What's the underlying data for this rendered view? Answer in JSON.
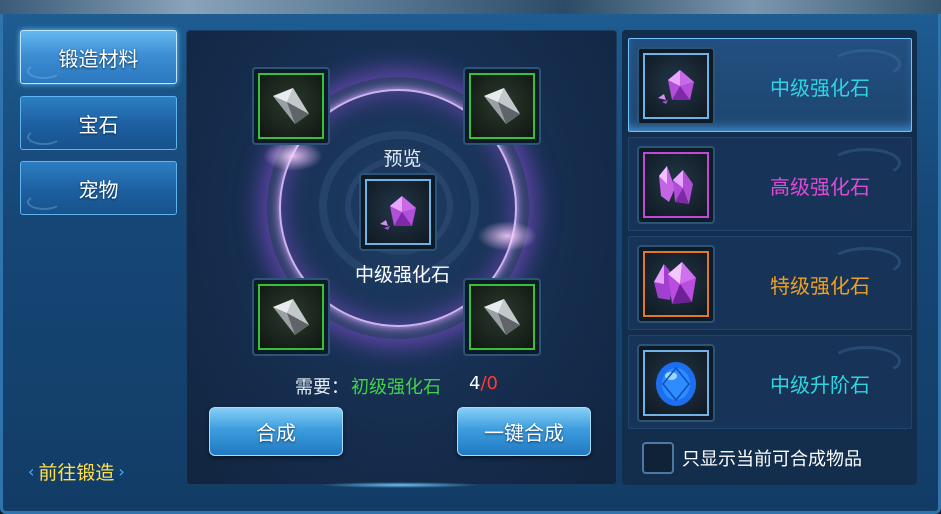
{
  "categories": [
    {
      "label": "锻造材料",
      "active": true
    },
    {
      "label": "宝石",
      "active": false
    },
    {
      "label": "宠物",
      "active": false
    }
  ],
  "goto_forge": "前往锻造",
  "center": {
    "preview_label": "预览",
    "preview_item_name": "中级强化石",
    "requirement_label": "需要：",
    "requirement_material": "初级强化石",
    "requirement_have": "4",
    "requirement_separator": "/",
    "requirement_need": "0",
    "synthesize_button": "合成",
    "synthesize_all_button": "一键合成"
  },
  "items": [
    {
      "name": "中级强化石",
      "color": "#2fd6e0",
      "icon": "purple-crystal-small-icon",
      "active": true
    },
    {
      "name": "高级强化石",
      "color": "#e04ad8",
      "icon": "purple-crystal-cluster-icon",
      "active": false
    },
    {
      "name": "特级强化石",
      "color": "#f0a020",
      "icon": "purple-crystal-large-icon",
      "active": false
    },
    {
      "name": "中级升阶石",
      "color": "#2fd6e0",
      "icon": "blue-gem-icon",
      "active": false
    }
  ],
  "filter_label": "只显示当前可合成物品"
}
